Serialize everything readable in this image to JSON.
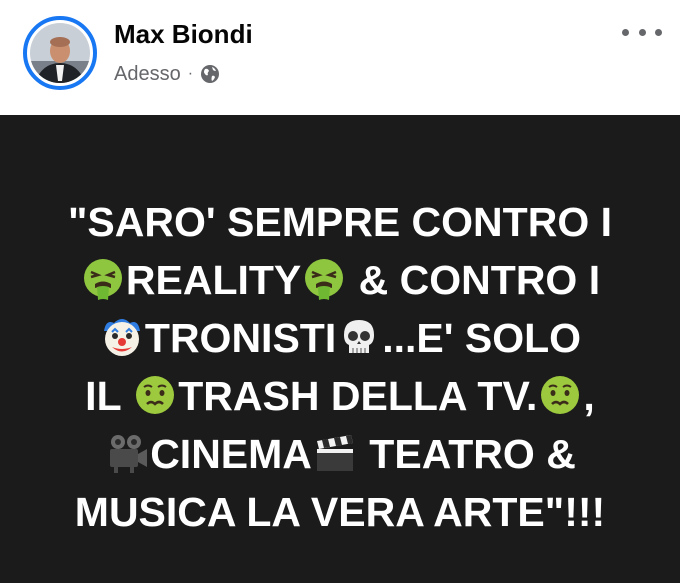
{
  "post": {
    "author": "Max Biondi",
    "timestamp": "Adesso",
    "separator": "·",
    "audience_icon": "globe-icon",
    "more_icon": "more-options-icon"
  },
  "quote": {
    "line1": "\"SARO' SEMPRE CONTRO I",
    "line2_a": "REALITY",
    "line2_b": " & CONTRO I",
    "line3_a": "TRONISTI",
    "line3_b": "...E' SOLO",
    "line4_a": "IL ",
    "line4_b": "TRASH DELLA TV.",
    "line4_c": ",",
    "line5_a": "CINEMA",
    "line5_b": " TEATRO &",
    "line6": "MUSICA LA VERA ARTE\"!!!",
    "emojis": [
      "vomiting-face",
      "clown-face",
      "skull",
      "nauseated-face",
      "movie-camera",
      "clapper-board"
    ]
  },
  "colors": {
    "background": "#1b1b1b",
    "text": "#ffffff",
    "avatar_ring": "#1877f2",
    "meta": "#65676b"
  }
}
